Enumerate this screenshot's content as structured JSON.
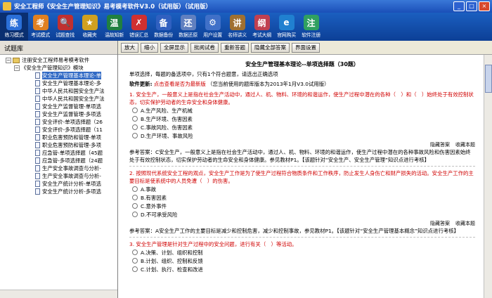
{
  "window": {
    "title": "安全工程师《安全生产管理知识》易考模考软件V3.0（试用版）（试用版）",
    "controls": [
      "_",
      "□",
      "×"
    ]
  },
  "toolbar": {
    "items": [
      {
        "label": "练习模式",
        "icon": "practice-icon",
        "color": "#2a6fd8",
        "glyph": "练"
      },
      {
        "label": "考试模式",
        "icon": "exam-icon",
        "color": "#e08020",
        "glyph": "考"
      },
      {
        "label": "试题查找",
        "icon": "search-icon",
        "color": "#c03030",
        "glyph": "🔍"
      },
      {
        "label": "收藏夹",
        "icon": "favorites-icon",
        "color": "#d0a020",
        "glyph": "★"
      },
      {
        "label": "温故知新",
        "icon": "review-icon",
        "color": "#208040",
        "glyph": "温"
      },
      {
        "label": "错误汇总",
        "icon": "errors-icon",
        "color": "#d03030",
        "glyph": "✗"
      },
      {
        "label": "数据备份",
        "icon": "backup-icon",
        "color": "#3060c0",
        "glyph": "备"
      },
      {
        "label": "数据还原",
        "icon": "restore-icon",
        "color": "#6080c0",
        "glyph": "还"
      },
      {
        "label": "用户设置",
        "icon": "user-settings-icon",
        "color": "#4070c8",
        "glyph": "⚙"
      },
      {
        "label": "名师讲义",
        "icon": "lecture-icon",
        "color": "#a07030",
        "glyph": "讲"
      },
      {
        "label": "考试大纲",
        "icon": "syllabus-icon",
        "color": "#c04050",
        "glyph": "纲"
      },
      {
        "label": "官网购买",
        "icon": "buy-icon",
        "color": "#2080d0",
        "glyph": "e"
      },
      {
        "label": "软件注册",
        "icon": "register-icon",
        "color": "#30a060",
        "glyph": "注"
      }
    ]
  },
  "sidebar": {
    "header": "试题库",
    "root": "注册安全工程师易考模考软件",
    "module": "《安全生产管理知识》模块",
    "items": [
      "安全生产管理基本理论-单",
      "安全生产管理基本理论-多",
      "中华人民共和国安全生产法",
      "中华人民共和国安全生产法",
      "安全生产监督管理-单项选",
      "安全生产监督管理-多项选",
      "安全评价-单项选择题（26",
      "安全评价-多项选择题（11",
      "职业危害预防和管理-单项",
      "职业危害预防和管理-多项",
      "应急管-单项选择题（45题",
      "应急管-多项选择题（24题",
      "生产安全事故调查与分析-",
      "生产安全事故调查与分析-",
      "安全生产统计分析-单项选",
      "安全生产统计分析-多项选"
    ]
  },
  "buttons": [
    "放大",
    "缩小",
    "全屏显示",
    "批阅试卷",
    "重新答题",
    "隐藏全部答案",
    "界面设置"
  ],
  "content": {
    "title": "安全生产管理基本理论--单项选择题（30题）",
    "instruction": "单项选择，每题的备选项中，只有1个符合题意，请选出正确选项",
    "update_label": "软件更新:",
    "update_link": "点击查看是否为最新版",
    "update_note": "（您当前使用的题库版本为2013年1月V3.0试用版）",
    "questions": [
      {
        "stem": "1. 安全生产，一般意义上是指在社会生产活动中，通过人、机、物料、环境的和谐运作，使生产过程中潜在的各种（　）和（　）始终处于有效控制状态，切实保护劳动者的生命安全和身体健康。",
        "options": [
          "A.生产风险、生产机械",
          "B.生产环境、伤害因素",
          "C.事故风险、伤害因素",
          "D.生产环境、事故风险"
        ],
        "actions": [
          "隐藏答案",
          "收藏本题"
        ],
        "answer": "参考答案：C安全生产，一般意义上是指在社会生产活动中，通过人、机、物料、环境的和谐运作，使生产过程中潜在的各种事故风险和伤害因素始终处于有效控制状态，切实保护劳动者的生命安全和身体健康。参见教材P1。【该题针对“安全生产、安全生产管理”知识点进行考核】"
      },
      {
        "stem": "2. 按照现代系统安全工程的观点，安全生产工作是为了使生产过程符合物质条件和工作秩序，防止发生人身伤亡和财产损失的活动。安全生产工作的主要目标是使系统中的人员免遭（　）的伤害。",
        "options": [
          "A.事故",
          "B.有害因素",
          "C.意外事件",
          "D.不可承受风险"
        ],
        "actions": [
          "隐藏答案",
          "收藏本题"
        ],
        "answer": "参考答案：A安全生产工作的主要目标是减少和控制危害，减少和控制事故，参见教材P1。【该题针对“安全生产管理基本概念”知识点进行考核】"
      },
      {
        "stem": "3. 安全生产管理是针对生产过程中的安全问题，进行有关（　）等活动。",
        "options": [
          "A.决策、计划、组织和控制",
          "B.计划、组织、控制和反馈",
          "C.计划、执行、检查和改进"
        ]
      }
    ]
  },
  "colors": {
    "toolbar_bg": "#0c3f96",
    "selected": "#316ac5",
    "question_red": "#d00000"
  }
}
